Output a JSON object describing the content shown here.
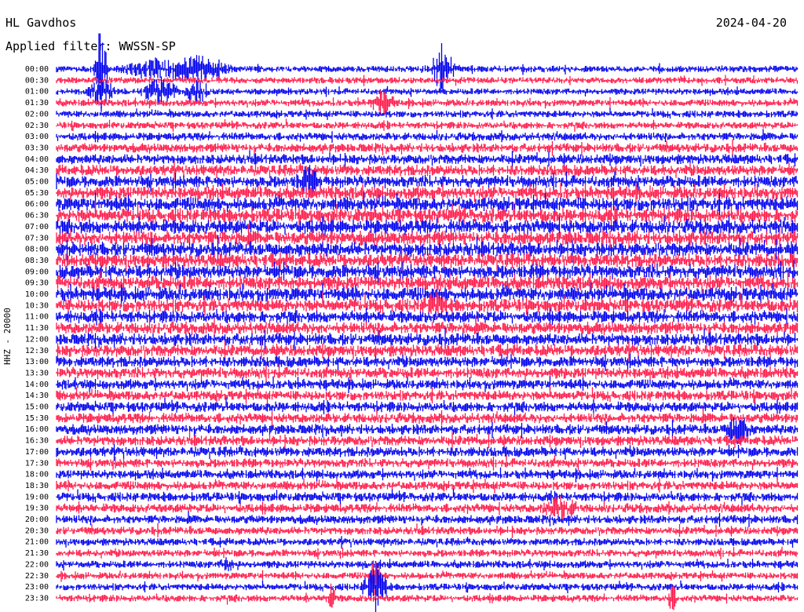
{
  "header": {
    "station": "HL Gavdhos",
    "date": "2024-04-20",
    "filter": "Applied filter: WWSSN-SP"
  },
  "channel_label": "HHZ - 20000",
  "colors": {
    "trace_a": "#0000ee",
    "trace_b": "#ff1a4a"
  },
  "chart_data": {
    "type": "line",
    "title": "HL Gavdhos",
    "subtitle": "Applied filter: WWSSN-SP",
    "ylabel": "HHZ - 20000",
    "row_labels": [
      "00:00",
      "00:30",
      "01:00",
      "01:30",
      "02:00",
      "02:30",
      "03:00",
      "03:30",
      "04:00",
      "04:30",
      "05:00",
      "05:30",
      "06:00",
      "06:30",
      "07:00",
      "07:30",
      "08:00",
      "08:30",
      "09:00",
      "09:30",
      "10:00",
      "10:30",
      "11:00",
      "11:30",
      "12:00",
      "12:30",
      "13:00",
      "13:30",
      "14:00",
      "14:30",
      "15:00",
      "15:30",
      "16:00",
      "16:30",
      "17:00",
      "17:30",
      "18:00",
      "18:30",
      "19:00",
      "19:30",
      "20:00",
      "20:30",
      "21:00",
      "21:30",
      "22:00",
      "22:30",
      "23:00",
      "23:30"
    ],
    "row_colors": [
      "trace_a",
      "trace_b"
    ],
    "noise_level": [
      0.25,
      0.25,
      0.25,
      0.3,
      0.3,
      0.3,
      0.4,
      0.5,
      0.6,
      0.7,
      0.8,
      0.9,
      1.0,
      1.0,
      1.0,
      1.0,
      1.0,
      1.0,
      1.0,
      1.0,
      1.0,
      0.9,
      0.8,
      0.8,
      0.8,
      0.8,
      0.7,
      0.7,
      0.6,
      0.6,
      0.6,
      0.6,
      0.6,
      0.6,
      0.6,
      0.5,
      0.5,
      0.5,
      0.5,
      0.5,
      0.45,
      0.4,
      0.35,
      0.35,
      0.35,
      0.3,
      0.3,
      0.3
    ],
    "events": [
      {
        "row": 0,
        "x": 0.06,
        "amp": 6.0,
        "dur": 0.01
      },
      {
        "row": 0,
        "x": 0.13,
        "amp": 1.2,
        "dur": 0.05
      },
      {
        "row": 0,
        "x": 0.19,
        "amp": 1.5,
        "dur": 0.05
      },
      {
        "row": 0,
        "x": 0.52,
        "amp": 3.0,
        "dur": 0.02
      },
      {
        "row": 2,
        "x": 0.06,
        "amp": 2.0,
        "dur": 0.02
      },
      {
        "row": 2,
        "x": 0.14,
        "amp": 1.5,
        "dur": 0.03
      },
      {
        "row": 2,
        "x": 0.19,
        "amp": 1.5,
        "dur": 0.02
      },
      {
        "row": 3,
        "x": 0.44,
        "amp": 1.5,
        "dur": 0.02
      },
      {
        "row": 10,
        "x": 0.34,
        "amp": 1.5,
        "dur": 0.02
      },
      {
        "row": 21,
        "x": 0.51,
        "amp": 1.2,
        "dur": 0.02
      },
      {
        "row": 32,
        "x": 0.92,
        "amp": 2.0,
        "dur": 0.02
      },
      {
        "row": 39,
        "x": 0.68,
        "amp": 1.2,
        "dur": 0.03
      },
      {
        "row": 44,
        "x": 0.23,
        "amp": 1.0,
        "dur": 0.01
      },
      {
        "row": 45,
        "x": 0.43,
        "amp": 2.5,
        "dur": 0.01
      },
      {
        "row": 46,
        "x": 0.43,
        "amp": 3.0,
        "dur": 0.02
      },
      {
        "row": 47,
        "x": 0.37,
        "amp": 1.5,
        "dur": 0.01
      },
      {
        "row": 47,
        "x": 0.83,
        "amp": 1.5,
        "dur": 0.01
      }
    ]
  }
}
